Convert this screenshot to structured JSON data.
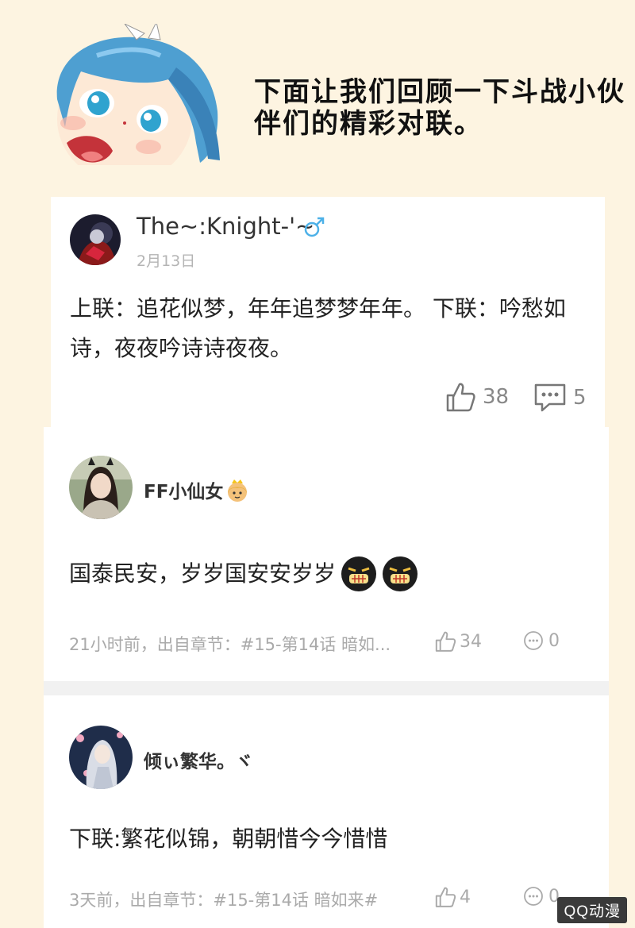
{
  "header": {
    "intro_text": "下面让我们回顾一下斗战小伙伴们的精彩对联。"
  },
  "comments": [
    {
      "username": "The~:Knight-'~",
      "gender_icon": "male-icon",
      "date": "2月13日",
      "content": "上联：追花似梦，年年追梦梦年年。 下联：吟愁如诗，夜夜吟诗诗夜夜。",
      "likes": "38",
      "replies": "5"
    },
    {
      "username": "FF小仙女",
      "badge_icon": "princess-emoji-icon",
      "content": "国泰民安，岁岁国安安岁岁",
      "emoji_icons": [
        "smirk-emoji-icon",
        "smirk-emoji-icon"
      ],
      "meta": "21小时前，出自章节：#15-第14话 暗如...",
      "likes": "34",
      "replies": "0"
    },
    {
      "username": "倾ぃ繁华。ヾ",
      "content": "下联:繁花似锦，朝朝惜今今惜惜",
      "meta": "3天前，出自章节：#15-第14话 暗如来#",
      "likes": "4",
      "replies": "0"
    }
  ],
  "watermark": "QQ动漫",
  "colors": {
    "background": "#fdf4e1",
    "card": "#ffffff",
    "gender_icon": "#4db1e8",
    "meta_text": "#aaaaaa"
  }
}
